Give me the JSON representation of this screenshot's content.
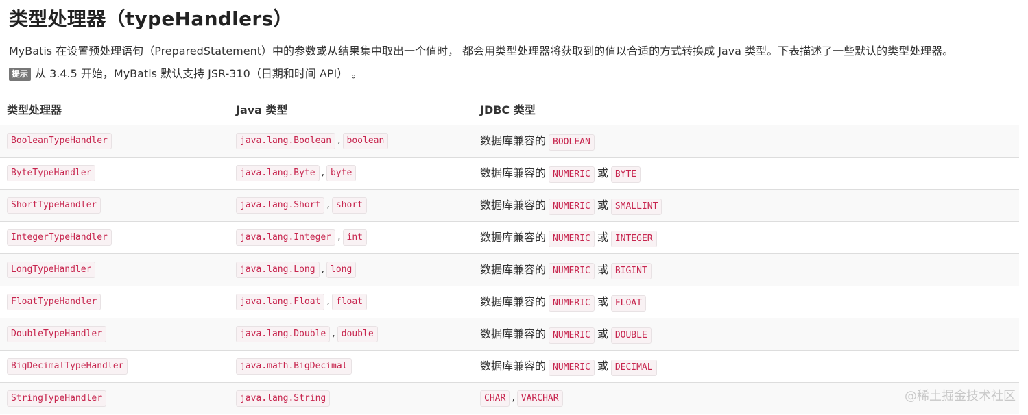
{
  "page": {
    "title": "类型处理器（typeHandlers）",
    "description": "MyBatis 在设置预处理语句（PreparedStatement）中的参数或从结果集中取出一个值时， 都会用类型处理器将获取到的值以合适的方式转换成 Java 类型。下表描述了一些默认的类型处理器。",
    "tip_badge": "提示",
    "tip_text": "从 3.4.5 开始，MyBatis 默认支持 JSR-310（日期和时间 API） 。",
    "watermark": "@稀土掘金技术社区"
  },
  "table": {
    "headers": [
      "类型处理器",
      "Java 类型",
      "JDBC 类型"
    ],
    "jdbc_prefix": "数据库兼容的",
    "or_word": "或",
    "separator": ",",
    "rows": [
      {
        "handler": "BooleanTypeHandler",
        "java": [
          "java.lang.Boolean",
          "boolean"
        ],
        "jdbc_compat": true,
        "jdbc": [
          "BOOLEAN"
        ]
      },
      {
        "handler": "ByteTypeHandler",
        "java": [
          "java.lang.Byte",
          "byte"
        ],
        "jdbc_compat": true,
        "jdbc": [
          "NUMERIC",
          "BYTE"
        ]
      },
      {
        "handler": "ShortTypeHandler",
        "java": [
          "java.lang.Short",
          "short"
        ],
        "jdbc_compat": true,
        "jdbc": [
          "NUMERIC",
          "SMALLINT"
        ]
      },
      {
        "handler": "IntegerTypeHandler",
        "java": [
          "java.lang.Integer",
          "int"
        ],
        "jdbc_compat": true,
        "jdbc": [
          "NUMERIC",
          "INTEGER"
        ]
      },
      {
        "handler": "LongTypeHandler",
        "java": [
          "java.lang.Long",
          "long"
        ],
        "jdbc_compat": true,
        "jdbc": [
          "NUMERIC",
          "BIGINT"
        ]
      },
      {
        "handler": "FloatTypeHandler",
        "java": [
          "java.lang.Float",
          "float"
        ],
        "jdbc_compat": true,
        "jdbc": [
          "NUMERIC",
          "FLOAT"
        ]
      },
      {
        "handler": "DoubleTypeHandler",
        "java": [
          "java.lang.Double",
          "double"
        ],
        "jdbc_compat": true,
        "jdbc": [
          "NUMERIC",
          "DOUBLE"
        ]
      },
      {
        "handler": "BigDecimalTypeHandler",
        "java": [
          "java.math.BigDecimal"
        ],
        "jdbc_compat": true,
        "jdbc": [
          "NUMERIC",
          "DECIMAL"
        ]
      },
      {
        "handler": "StringTypeHandler",
        "java": [
          "java.lang.String"
        ],
        "jdbc_compat": false,
        "jdbc": [
          "CHAR",
          "VARCHAR"
        ]
      }
    ]
  }
}
